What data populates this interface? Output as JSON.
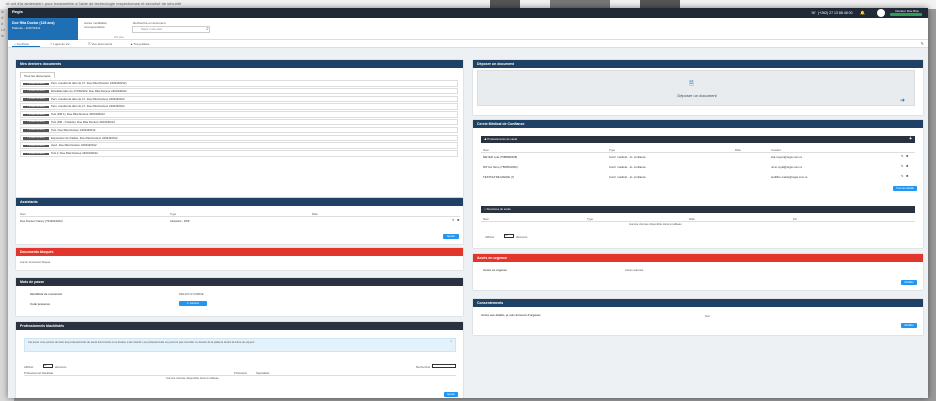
{
  "background": {
    "strip_text": "nt ont d'la aintensien: pour transmettre à l'aide de technologie respectueuse et sécurisé de sécurité",
    "left_lines": [
      "le",
      "d'",
      "à",
      "Le",
      "le"
    ]
  },
  "topbar": {
    "logo": "Regis",
    "phone": "(+262) 27 13 88 48 00",
    "phone_icon": "headset-icon",
    "user_name": "Docteur Doe Rita",
    "accent": "#2e9e55"
  },
  "patient": {
    "name": "Doe Rita Doctor (126 ans)",
    "subtitle": "Patiente - 11/07/1911"
  },
  "header": {
    "access_label": "Accès modifiable correspondante",
    "search_label": "Recherche un document",
    "search_placeholder": "Saisir mots-clés",
    "small_text": "Voir plus"
  },
  "tabs": [
    "Synthèse",
    "Ligne de vie",
    "Vue documents",
    "Top jeHélve"
  ],
  "docs": {
    "title": "Mes derniers documents",
    "tab": "Tous les documents",
    "rows": [
      {
        "badge": "1 ESSENTIEL ADM",
        "text": "Pers. résultat de labo du 17. Doe Rita (Docteur 2403440012)"
      },
      {
        "badge": "1 ESSENTIEL ADM",
        "text": "Résultats labo du 17/09/2022. Doe Rita Docteur 2403440012"
      },
      {
        "badge": "1 ESSENTIEL ADM",
        "text": "Pers. résultat de labo du 17. Doe Rita Docteur 2403440012"
      },
      {
        "badge": "1 ESSENTIEL ADM",
        "text": "Pers. résultat de labo du 17. Doe Rita Docteur 2403440012"
      },
      {
        "badge": "1 ESSENTIEL ADM",
        "text": "Test (DM 1). Doe Rita Docteur 2403440012"
      },
      {
        "badge": "1 ESSENTIEL ADM",
        "text": "Test (DM - Chassis). Doe Rita Docteur 2403440012"
      },
      {
        "badge": "1 ESSENTIEL ADM",
        "text": "Test. Doe Rita Docteur 2403440012"
      },
      {
        "badge": "1 ESSENTIEL ADM",
        "text": "Expression de théâtre. Doe Rita Docteur 2403440012"
      },
      {
        "badge": "1 ESSENTIEL ADM",
        "text": "Avez. Doe Rita Docteur 2403440012"
      },
      {
        "badge": "1 ESSENTIEL ADM",
        "text": "Test 2. Doe Rita Docteur 2403440012"
      }
    ]
  },
  "assistants": {
    "title": "Assistants",
    "cols": [
      "Nom",
      "Type",
      "Rôle"
    ],
    "row": {
      "name": "Doe Docteur Nancy (7543644322)",
      "type": "Assistant - DSP",
      "role": ""
    },
    "button": "Ajouter"
  },
  "blocked": {
    "title": "Documents bloqués",
    "text": "Aucun document bloqué"
  },
  "password": {
    "title": "Mots de passe",
    "label1": "Identifiant de connexion",
    "value1": "DR120713 CABINE",
    "label2": "Code présence",
    "button": "Générer"
  },
  "blacklist": {
    "title": "Professionnels blacklistés",
    "note": "Cet écran vous permet de lister des professionnels de santé dont l'accès à ce dossier a été interdit. Les professionnels ne pourront pas consulter ce dossier de la patiente durant la durée du support.",
    "show_label": "Afficher",
    "select": "10",
    "entries": "éléments",
    "search": "Rechercher :",
    "col_name": "Professionnel blacklisté",
    "col_prof": "Profession",
    "col_spec": "Spécialités",
    "empty": "Aucune donnée disponible dans le tableau",
    "button": "Ajouter"
  },
  "upload": {
    "title": "Déposer un document",
    "label": "Déposer un document",
    "icon": "upload-icon",
    "arrow": "arrow-right-icon"
  },
  "trust": {
    "title": "Cercle Médical de Confiance",
    "sub": "Professionnels de santé",
    "cols": [
      "Nom",
      "Type",
      "Rôle",
      "Contact"
    ],
    "rows": [
      {
        "name": "MEYER Lola (7588989408)",
        "type": "Contr. médical - Jo. confiance",
        "contact": "lola.meyer@regis.com.re"
      },
      {
        "name": "ROYAL Nimo (7580501006)",
        "type": "Contr. médical - Jo. confiance",
        "contact": "nimo.royal@regis.com.re"
      },
      {
        "name": "TESTFILTRE MAIRIE (7)",
        "type": "Contr. médical - Jo. confiance",
        "contact": "testfiltre.mairie@regis.com.re"
      }
    ],
    "button": "Tous les détails",
    "sub2": "Structures de santé",
    "cols2": [
      "Nom",
      "Type",
      "Rôle",
      "Fin"
    ],
    "empty": "Aucune donnée disponible dans le tableau",
    "show_label": "Afficher",
    "select": "10",
    "entries": "éléments"
  },
  "emergency": {
    "title": "Accès en urgence",
    "label": "Accès en urgence",
    "value": "Accès autorisé",
    "button": "Modifier"
  },
  "consent": {
    "title": "Consentements",
    "label": "Accès aux détails, je suis donneur d'organes",
    "value": "Non",
    "button": "Modifier"
  }
}
